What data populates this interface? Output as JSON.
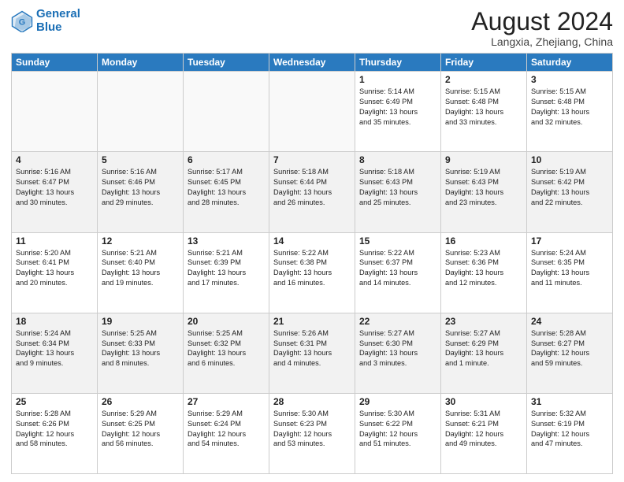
{
  "header": {
    "logo_line1": "General",
    "logo_line2": "Blue",
    "month_title": "August 2024",
    "location": "Langxia, Zhejiang, China"
  },
  "days_of_week": [
    "Sunday",
    "Monday",
    "Tuesday",
    "Wednesday",
    "Thursday",
    "Friday",
    "Saturday"
  ],
  "weeks": [
    [
      {
        "day": "",
        "info": ""
      },
      {
        "day": "",
        "info": ""
      },
      {
        "day": "",
        "info": ""
      },
      {
        "day": "",
        "info": ""
      },
      {
        "day": "1",
        "info": "Sunrise: 5:14 AM\nSunset: 6:49 PM\nDaylight: 13 hours\nand 35 minutes."
      },
      {
        "day": "2",
        "info": "Sunrise: 5:15 AM\nSunset: 6:48 PM\nDaylight: 13 hours\nand 33 minutes."
      },
      {
        "day": "3",
        "info": "Sunrise: 5:15 AM\nSunset: 6:48 PM\nDaylight: 13 hours\nand 32 minutes."
      }
    ],
    [
      {
        "day": "4",
        "info": "Sunrise: 5:16 AM\nSunset: 6:47 PM\nDaylight: 13 hours\nand 30 minutes."
      },
      {
        "day": "5",
        "info": "Sunrise: 5:16 AM\nSunset: 6:46 PM\nDaylight: 13 hours\nand 29 minutes."
      },
      {
        "day": "6",
        "info": "Sunrise: 5:17 AM\nSunset: 6:45 PM\nDaylight: 13 hours\nand 28 minutes."
      },
      {
        "day": "7",
        "info": "Sunrise: 5:18 AM\nSunset: 6:44 PM\nDaylight: 13 hours\nand 26 minutes."
      },
      {
        "day": "8",
        "info": "Sunrise: 5:18 AM\nSunset: 6:43 PM\nDaylight: 13 hours\nand 25 minutes."
      },
      {
        "day": "9",
        "info": "Sunrise: 5:19 AM\nSunset: 6:43 PM\nDaylight: 13 hours\nand 23 minutes."
      },
      {
        "day": "10",
        "info": "Sunrise: 5:19 AM\nSunset: 6:42 PM\nDaylight: 13 hours\nand 22 minutes."
      }
    ],
    [
      {
        "day": "11",
        "info": "Sunrise: 5:20 AM\nSunset: 6:41 PM\nDaylight: 13 hours\nand 20 minutes."
      },
      {
        "day": "12",
        "info": "Sunrise: 5:21 AM\nSunset: 6:40 PM\nDaylight: 13 hours\nand 19 minutes."
      },
      {
        "day": "13",
        "info": "Sunrise: 5:21 AM\nSunset: 6:39 PM\nDaylight: 13 hours\nand 17 minutes."
      },
      {
        "day": "14",
        "info": "Sunrise: 5:22 AM\nSunset: 6:38 PM\nDaylight: 13 hours\nand 16 minutes."
      },
      {
        "day": "15",
        "info": "Sunrise: 5:22 AM\nSunset: 6:37 PM\nDaylight: 13 hours\nand 14 minutes."
      },
      {
        "day": "16",
        "info": "Sunrise: 5:23 AM\nSunset: 6:36 PM\nDaylight: 13 hours\nand 12 minutes."
      },
      {
        "day": "17",
        "info": "Sunrise: 5:24 AM\nSunset: 6:35 PM\nDaylight: 13 hours\nand 11 minutes."
      }
    ],
    [
      {
        "day": "18",
        "info": "Sunrise: 5:24 AM\nSunset: 6:34 PM\nDaylight: 13 hours\nand 9 minutes."
      },
      {
        "day": "19",
        "info": "Sunrise: 5:25 AM\nSunset: 6:33 PM\nDaylight: 13 hours\nand 8 minutes."
      },
      {
        "day": "20",
        "info": "Sunrise: 5:25 AM\nSunset: 6:32 PM\nDaylight: 13 hours\nand 6 minutes."
      },
      {
        "day": "21",
        "info": "Sunrise: 5:26 AM\nSunset: 6:31 PM\nDaylight: 13 hours\nand 4 minutes."
      },
      {
        "day": "22",
        "info": "Sunrise: 5:27 AM\nSunset: 6:30 PM\nDaylight: 13 hours\nand 3 minutes."
      },
      {
        "day": "23",
        "info": "Sunrise: 5:27 AM\nSunset: 6:29 PM\nDaylight: 13 hours\nand 1 minute."
      },
      {
        "day": "24",
        "info": "Sunrise: 5:28 AM\nSunset: 6:27 PM\nDaylight: 12 hours\nand 59 minutes."
      }
    ],
    [
      {
        "day": "25",
        "info": "Sunrise: 5:28 AM\nSunset: 6:26 PM\nDaylight: 12 hours\nand 58 minutes."
      },
      {
        "day": "26",
        "info": "Sunrise: 5:29 AM\nSunset: 6:25 PM\nDaylight: 12 hours\nand 56 minutes."
      },
      {
        "day": "27",
        "info": "Sunrise: 5:29 AM\nSunset: 6:24 PM\nDaylight: 12 hours\nand 54 minutes."
      },
      {
        "day": "28",
        "info": "Sunrise: 5:30 AM\nSunset: 6:23 PM\nDaylight: 12 hours\nand 53 minutes."
      },
      {
        "day": "29",
        "info": "Sunrise: 5:30 AM\nSunset: 6:22 PM\nDaylight: 12 hours\nand 51 minutes."
      },
      {
        "day": "30",
        "info": "Sunrise: 5:31 AM\nSunset: 6:21 PM\nDaylight: 12 hours\nand 49 minutes."
      },
      {
        "day": "31",
        "info": "Sunrise: 5:32 AM\nSunset: 6:19 PM\nDaylight: 12 hours\nand 47 minutes."
      }
    ]
  ]
}
